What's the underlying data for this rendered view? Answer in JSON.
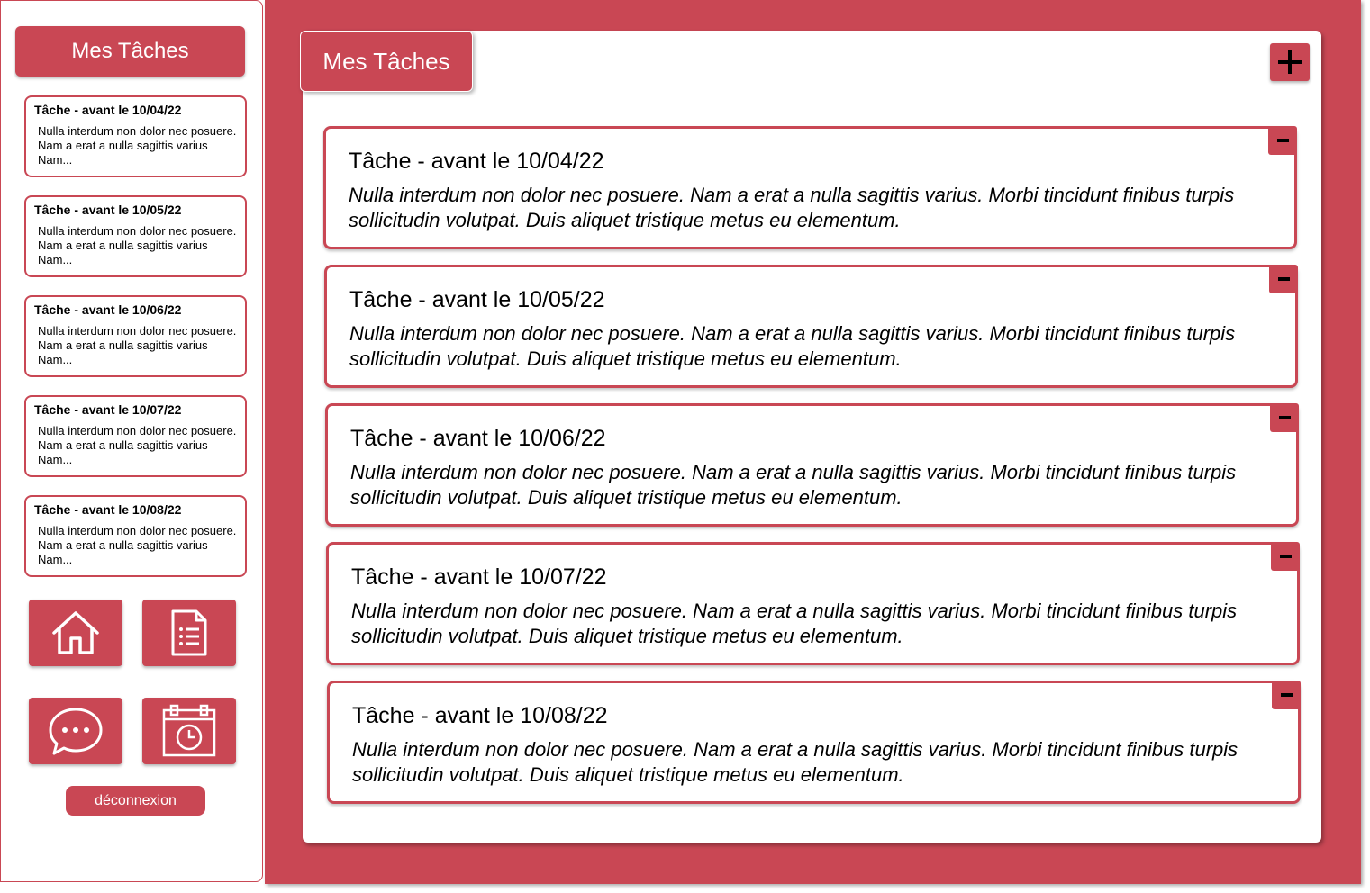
{
  "sidebar": {
    "title": "Mes Tâches",
    "tasks": [
      {
        "title": "Tâche - avant le 10/04/22",
        "body": "Nulla interdum non dolor nec posuere. Nam a erat a nulla sagittis varius Nam..."
      },
      {
        "title": "Tâche - avant le 10/05/22",
        "body": "Nulla interdum non dolor nec posuere. Nam a erat a nulla sagittis varius Nam..."
      },
      {
        "title": "Tâche - avant le 10/06/22",
        "body": "Nulla interdum non dolor nec posuere. Nam a erat a nulla sagittis varius Nam..."
      },
      {
        "title": "Tâche - avant le 10/07/22",
        "body": "Nulla interdum non dolor nec posuere. Nam a erat a nulla sagittis varius Nam..."
      },
      {
        "title": "Tâche - avant le 10/08/22",
        "body": "Nulla interdum non dolor nec posuere. Nam a erat a nulla sagittis varius Nam..."
      }
    ],
    "nav": [
      {
        "icon": "home-icon"
      },
      {
        "icon": "document-list-icon"
      },
      {
        "icon": "chat-bubble-icon"
      },
      {
        "icon": "calendar-clock-icon"
      }
    ],
    "logout_label": "déconnexion"
  },
  "main": {
    "title": "Mes Tâches",
    "add_icon": "plus-icon",
    "tasks": [
      {
        "title": "Tâche - avant le 10/04/22",
        "body": "Nulla interdum non dolor nec posuere. Nam a erat a nulla sagittis varius. Morbi tincidunt finibus turpis sollicitudin volutpat. Duis aliquet tristique metus eu elementum."
      },
      {
        "title": "Tâche - avant le 10/05/22",
        "body": "Nulla interdum non dolor nec posuere. Nam a erat a nulla sagittis varius. Morbi tincidunt finibus turpis sollicitudin volutpat. Duis aliquet tristique metus eu elementum."
      },
      {
        "title": "Tâche - avant le 10/06/22",
        "body": "Nulla interdum non dolor nec posuere. Nam a erat a nulla sagittis varius. Morbi tincidunt finibus turpis sollicitudin volutpat. Duis aliquet tristique metus eu elementum."
      },
      {
        "title": "Tâche - avant le 10/07/22",
        "body": "Nulla interdum non dolor nec posuere. Nam a erat a nulla sagittis varius. Morbi tincidunt finibus turpis sollicitudin volutpat. Duis aliquet tristique metus eu elementum."
      },
      {
        "title": "Tâche - avant le 10/08/22",
        "body": "Nulla interdum non dolor nec posuere. Nam a erat a nulla sagittis varius. Morbi tincidunt finibus turpis sollicitudin volutpat. Duis aliquet tristique metus eu elementum."
      }
    ]
  },
  "colors": {
    "accent": "#c94754",
    "background": "#ffffff",
    "text": "#000000"
  }
}
